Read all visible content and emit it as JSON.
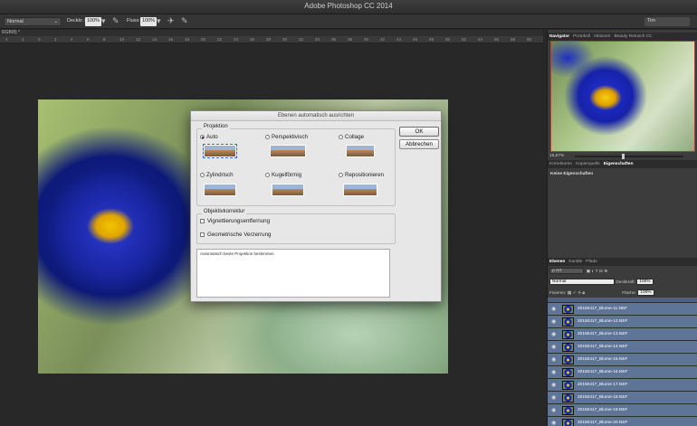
{
  "app": {
    "title": "Adobe Photoshop CC 2014"
  },
  "options": {
    "mode": "Normal",
    "opacity_label": "Deckkr.:",
    "opacity_value": "100%",
    "flow_label": "Fluss:",
    "flow_value": "100%",
    "user": "Tim"
  },
  "document": {
    "tab": "RGB/8) *"
  },
  "ruler": [
    "4",
    "2",
    "0",
    "2",
    "4",
    "6",
    "8",
    "10",
    "12",
    "14",
    "16",
    "18",
    "20",
    "22",
    "24",
    "26",
    "28",
    "30",
    "32",
    "34",
    "36",
    "38",
    "40",
    "42",
    "44",
    "46",
    "48",
    "50",
    "52",
    "54",
    "56",
    "58",
    "60"
  ],
  "dialog": {
    "title": "Ebenen automatisch ausrichten",
    "projection_label": "Projektion",
    "options": [
      {
        "label": "Auto",
        "selected": true
      },
      {
        "label": "Perspektivisch",
        "selected": false
      },
      {
        "label": "Collage",
        "selected": false
      },
      {
        "label": "Zylindrisch",
        "selected": false
      },
      {
        "label": "Kugelförmig",
        "selected": false
      },
      {
        "label": "Repositionieren",
        "selected": false
      }
    ],
    "lens_label": "Objektivkorrektur",
    "vignette_label": "Vignettierungsentfernung",
    "distortion_label": "Geometrische Verzerrung",
    "description": "Automatisch beste Projektion bestimmen.",
    "ok_label": "OK",
    "cancel_label": "Abbrechen"
  },
  "panels": {
    "top_tabs": [
      "Navigator",
      "Protokoll",
      "Aktionen",
      "Beauty Retusch CC"
    ],
    "zoom": "16,67%",
    "prop_tabs": [
      "Korrekturen",
      "Kopierquelle",
      "Eigenschaften"
    ],
    "no_properties": "Keine Eigenschaften",
    "layer_tabs": [
      "Ebenen",
      "Kanäle",
      "Pfade"
    ],
    "kind_label": "ρ Art",
    "blend": "Normal",
    "opacity_label": "Deckkraft:",
    "opacity_value": "100%",
    "lock_label": "Fixieren:",
    "fill_label": "Fläche:",
    "fill_value": "100%"
  },
  "layers": [
    "20150417_Blume-11.NEF",
    "20150417_Blume-12.NEF",
    "20150417_Blume-13.NEF",
    "20150417_Blume-14.NEF",
    "20150417_Blume-15.NEF",
    "20150417_Blume-16.NEF",
    "20150417_Blume-17.NEF",
    "20150417_Blume-18.NEF",
    "20150417_Blume-19.NEF",
    "20150417_Blume-20.NEF"
  ]
}
